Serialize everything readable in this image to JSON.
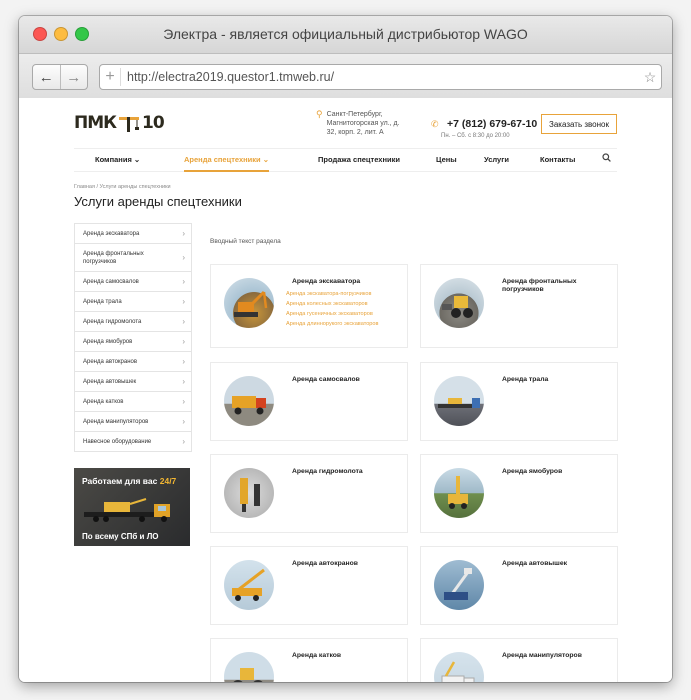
{
  "window": {
    "title": "Электра - является официальный дистрибьютор WAGO"
  },
  "browser": {
    "url": "http://electra2019.questor1.tmweb.ru/",
    "back_icon": "arrow-left-icon",
    "forward_icon": "arrow-right-icon",
    "bookmark_icon": "star-icon"
  },
  "header": {
    "logo_left": "ПМК",
    "logo_right": "10",
    "address": "Санкт-Петербург, Магнитогорская ул., д. 32, корп. 2, лит. А",
    "phone": "+7 (812) 679-67-10",
    "hours": "Пн. – Сб. с 8:30 до 20:00",
    "call_button": "Заказать звонок"
  },
  "nav": {
    "items": [
      {
        "label": "Компания",
        "has_dropdown": true
      },
      {
        "label": "Аренда спецтехники",
        "has_dropdown": true,
        "active": true
      },
      {
        "label": "Продажа спецтехники"
      },
      {
        "label": "Цены"
      },
      {
        "label": "Услуги"
      },
      {
        "label": "Контакты"
      }
    ]
  },
  "breadcrumbs": {
    "home": "Главная",
    "sep": "/",
    "current": "Услуги аренды спецтехники"
  },
  "page_title": "Услуги аренды спецтехники",
  "sidebar": {
    "items": [
      "Аренда экскаватора",
      "Аренда фронтальных погрузчиков",
      "Аренда самосвалов",
      "Аренда трала",
      "Аренда гидромолота",
      "Аренда ямобуров",
      "Аренда автокранов",
      "Аренда автовышек",
      "Аренда катков",
      "Аренда манипуляторов",
      "Навесное оборудование"
    ]
  },
  "promo": {
    "line1": "Работаем для вас",
    "line1_accent": "24/7",
    "line2": "По всему СПб и ЛО"
  },
  "intro_text": "Вводный текст раздела",
  "cards": [
    {
      "title": "Аренда экскаватора",
      "links": [
        "Аренда экскаватора-погрузчиков",
        "Аренда колесных экскаваторов",
        "Аренда гусеничных экскаваторов",
        "Аренда длиннорукого экскаваторов"
      ]
    },
    {
      "title": "Аренда фронтальных погрузчиков",
      "links": []
    },
    {
      "title": "Аренда самосвалов",
      "links": []
    },
    {
      "title": "Аренда трала",
      "links": []
    },
    {
      "title": "Аренда гидромолота",
      "links": []
    },
    {
      "title": "Аренда ямобуров",
      "links": []
    },
    {
      "title": "Аренда автокранов",
      "links": []
    },
    {
      "title": "Аренда автовышек",
      "links": []
    },
    {
      "title": "Аренда катков",
      "links": []
    },
    {
      "title": "Аренда манипуляторов",
      "links": []
    }
  ],
  "colors": {
    "accent": "#e8a33a",
    "text": "#222222",
    "border": "#ebebeb"
  }
}
